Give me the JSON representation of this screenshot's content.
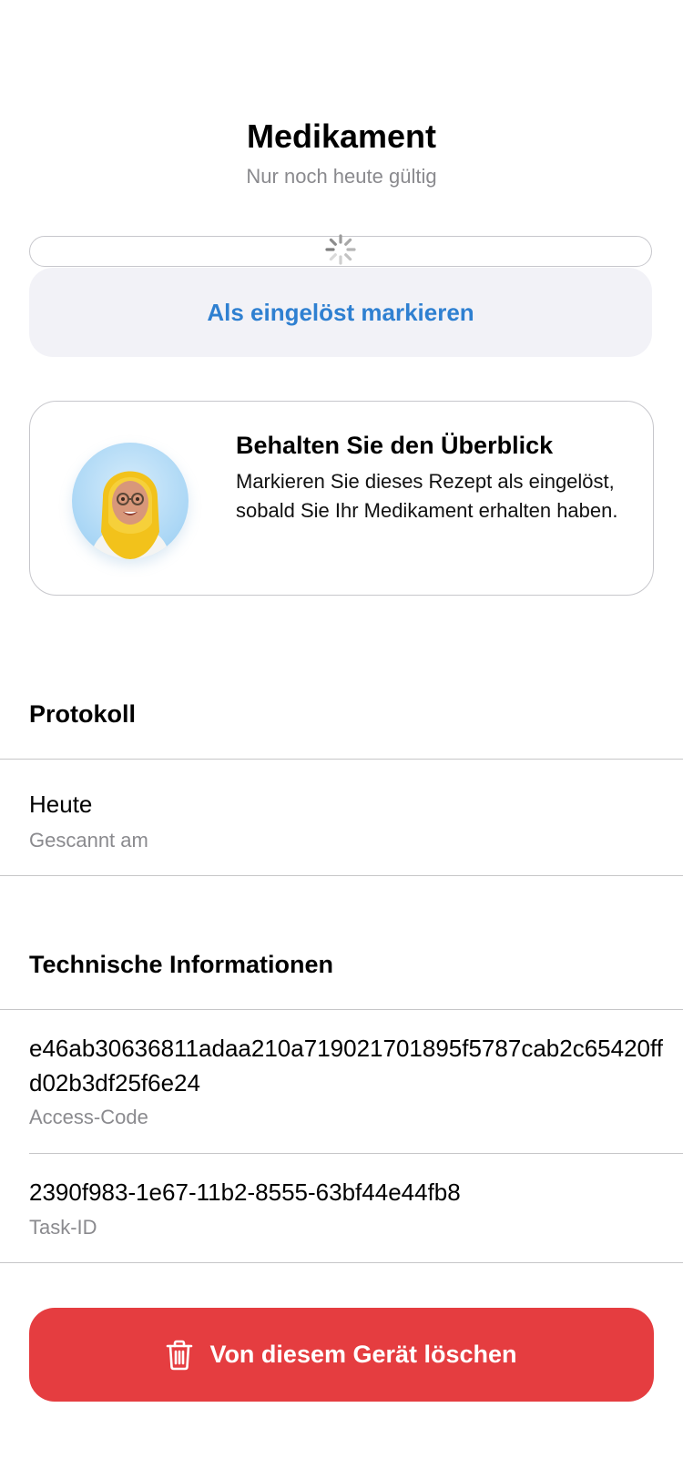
{
  "header": {
    "title": "Medikament",
    "subtitle": "Nur noch heute gültig"
  },
  "actions": {
    "redeem_label": "Als eingelöst markieren",
    "delete_label": "Von diesem Gerät löschen"
  },
  "info_card": {
    "title": "Behalten Sie den Überblick",
    "body": "Markieren Sie dieses Rezept als eingelöst, sobald Sie Ihr Medikament erhalten haben."
  },
  "protocol": {
    "section_title": "Protokoll",
    "entries": [
      {
        "value": "Heute",
        "label": "Gescannt am"
      }
    ]
  },
  "technical": {
    "section_title": "Technische Informationen",
    "access_code": {
      "value": "e46ab30636811adaa210a719021701895f5787cab2c65420ffd02b3df25f6e24",
      "label": "Access-Code"
    },
    "task_id": {
      "value": "2390f983-1e67-11b2-8555-63bf44e44fb8",
      "label": "Task-ID"
    }
  },
  "icons": {
    "loading": "spinner-icon",
    "trash": "trash-icon",
    "avatar": "pharmacist-avatar"
  },
  "colors": {
    "accent_blue": "#2f80d1",
    "delete_red": "#e53d40",
    "secondary_text": "#8a8a8e",
    "button_bg": "#f2f2f7"
  }
}
